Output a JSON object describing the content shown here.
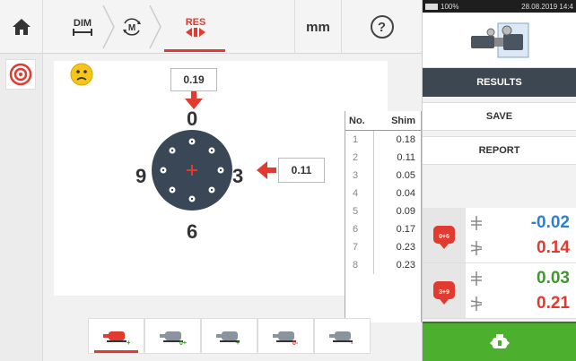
{
  "toolbar": {
    "dim_label": "DIM",
    "m_label": "M",
    "res_label": "RES",
    "unit": "mm",
    "help": "?"
  },
  "measurement": {
    "top_value": "0.19",
    "right_value": "0.11",
    "clock_top": "0",
    "clock_left": "9",
    "clock_right": "3",
    "clock_bottom": "6"
  },
  "shim_table": {
    "headers": [
      "No.",
      "Shim"
    ],
    "rows": [
      {
        "no": "1",
        "shim": "0.18"
      },
      {
        "no": "2",
        "shim": "0.11"
      },
      {
        "no": "3",
        "shim": "0.05"
      },
      {
        "no": "4",
        "shim": "0.04"
      },
      {
        "no": "5",
        "shim": "0.09"
      },
      {
        "no": "6",
        "shim": "0.17"
      },
      {
        "no": "7",
        "shim": "0.23"
      },
      {
        "no": "8",
        "shim": "0.23"
      }
    ]
  },
  "status_bar": {
    "battery": "100%",
    "datetime": "28.08.2019 14:4"
  },
  "right_panel": {
    "results_label": "RESULTS",
    "save_label": "SAVE",
    "report_label": "REPORT",
    "vertical": {
      "icon_text": "0+6",
      "offset": "-0.02",
      "angularity": "0.14"
    },
    "horizontal": {
      "icon_text": "3+9",
      "offset": "0.03",
      "angularity": "0.21"
    }
  },
  "colors": {
    "accent_red": "#e23a2e",
    "blue_value": "#2b7fd6",
    "green_value": "#3a9a2a",
    "results_bar": "#3d4751",
    "go_green": "#4caf2e"
  }
}
